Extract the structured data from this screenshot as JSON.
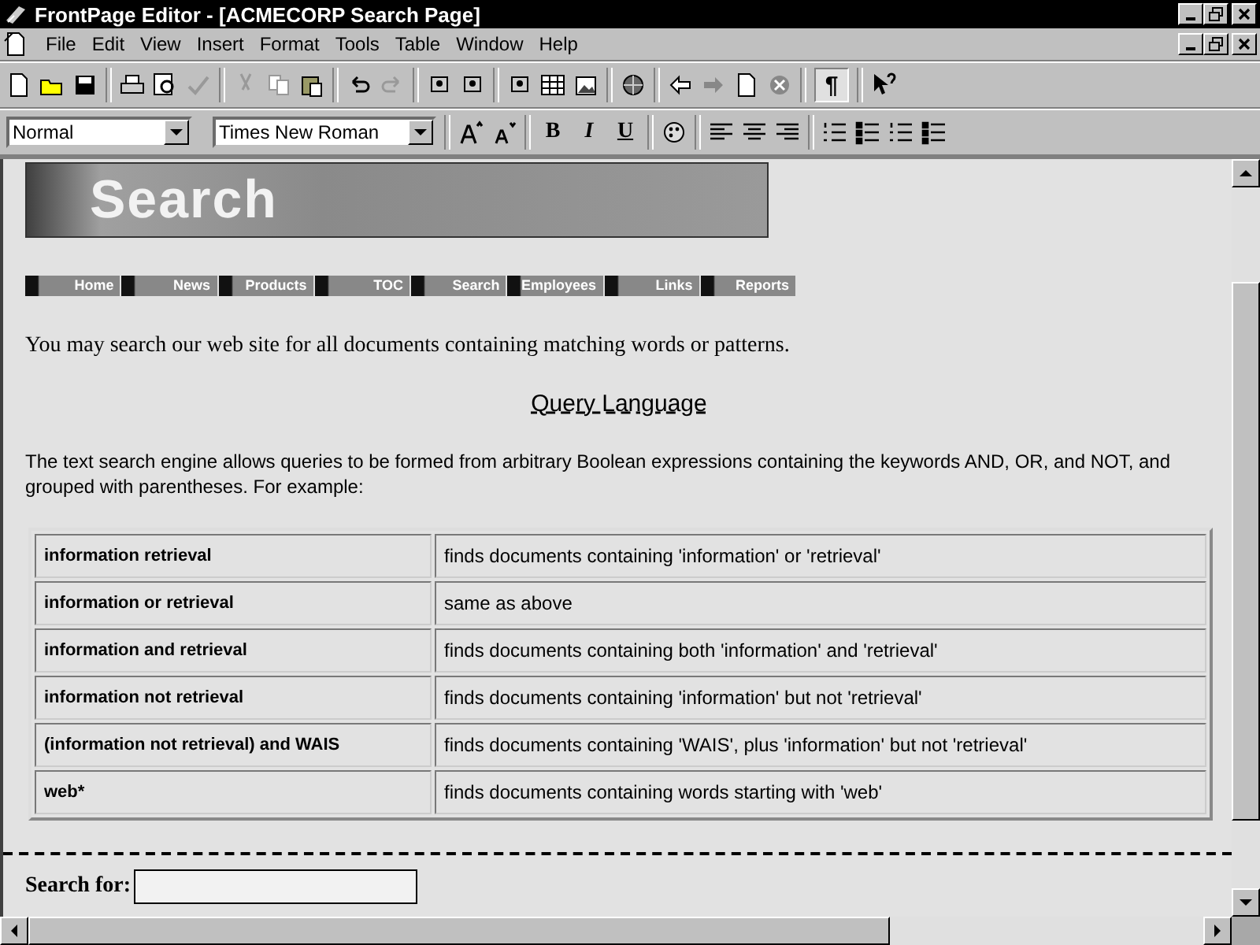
{
  "window": {
    "title": "FrontPage Editor - [ACMECORP Search Page]"
  },
  "menu": [
    "File",
    "Edit",
    "View",
    "Insert",
    "Format",
    "Tools",
    "Table",
    "Window",
    "Help"
  ],
  "format_bar": {
    "style": "Normal",
    "font": "Times New Roman",
    "bold": "B",
    "italic": "I",
    "underline": "U"
  },
  "toolbar": {
    "paragraph_mark": "¶",
    "paragraph_marks_on": true
  },
  "banner": {
    "title": "Search"
  },
  "nav": [
    {
      "label": "Home"
    },
    {
      "label": "News"
    },
    {
      "label": "Products"
    },
    {
      "label": "TOC"
    },
    {
      "label": "Search"
    },
    {
      "label": "Employees"
    },
    {
      "label": "Links"
    },
    {
      "label": "Reports"
    }
  ],
  "intro": "You may search our web site for all documents containing matching words or patterns.",
  "heading": "Query Language",
  "description": "The text search engine allows queries to be formed from arbitrary Boolean expressions containing the keywords AND, OR, and NOT, and grouped with parentheses. For example:",
  "table": {
    "rows": [
      {
        "query": "information retrieval",
        "meaning": "finds documents containing 'information' or 'retrieval'"
      },
      {
        "query": "information or retrieval",
        "meaning": "same as above"
      },
      {
        "query": "information and retrieval",
        "meaning": "finds documents containing both 'information' and 'retrieval'"
      },
      {
        "query": "information not retrieval",
        "meaning": "finds documents containing 'information' but not 'retrieval'"
      },
      {
        "query": "(information not retrieval) and WAIS",
        "meaning": "finds documents containing 'WAIS', plus 'information' but not 'retrieval'"
      },
      {
        "query": "web*",
        "meaning": "finds documents containing words starting with 'web'"
      }
    ]
  },
  "form": {
    "label": "Search for:"
  }
}
